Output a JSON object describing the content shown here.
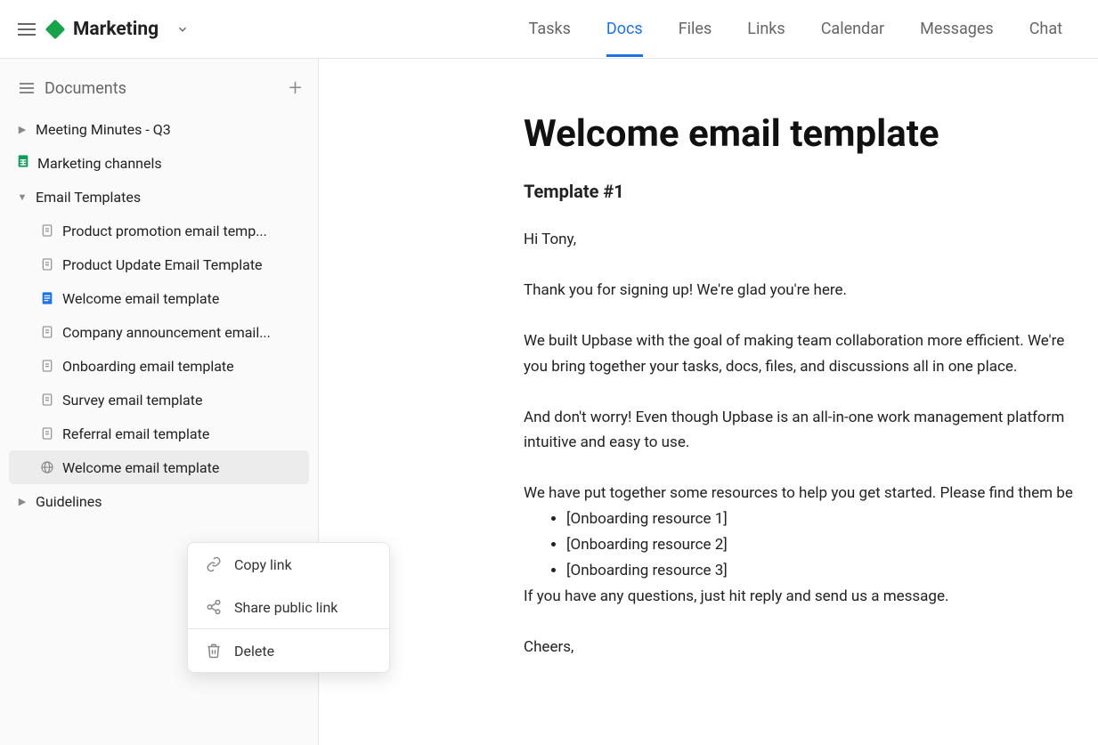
{
  "header": {
    "workspace": "Marketing",
    "tabs": [
      "Tasks",
      "Docs",
      "Files",
      "Links",
      "Calendar",
      "Messages",
      "Chat"
    ],
    "active_tab": "Docs"
  },
  "sidebar": {
    "title": "Documents",
    "items": [
      {
        "label": "Meeting Minutes - Q3",
        "type": "folder",
        "caret": "right"
      },
      {
        "label": "Marketing channels",
        "type": "sheets",
        "caret": "none"
      },
      {
        "label": "Email Templates",
        "type": "folder",
        "caret": "down",
        "children": [
          {
            "label": "Product promotion email temp...",
            "type": "doc"
          },
          {
            "label": "Product Update Email Template",
            "type": "doc"
          },
          {
            "label": "Welcome email template",
            "type": "gdoc"
          },
          {
            "label": "Company announcement email...",
            "type": "doc"
          },
          {
            "label": "Onboarding email template",
            "type": "doc"
          },
          {
            "label": "Survey email template",
            "type": "doc"
          },
          {
            "label": "Referral email template",
            "type": "doc"
          },
          {
            "label": "Welcome email template",
            "type": "public",
            "highlighted": true
          }
        ]
      },
      {
        "label": "Guidelines",
        "type": "folder",
        "caret": "right"
      }
    ]
  },
  "context_menu": {
    "copy_link": "Copy link",
    "share_public": "Share public link",
    "delete": "Delete"
  },
  "document": {
    "title": "Welcome email template",
    "section": "Template #1",
    "greeting": "Hi Tony,",
    "p1": "Thank you for signing up! We're glad you're here.",
    "p2a": "We built Upbase with the goal of making team collaboration more efficient. We're",
    "p2b": "you bring together your tasks, docs, files, and discussions all in one place.",
    "p3a": "And don't worry! Even though Upbase is an all-in-one work management platform",
    "p3b": "intuitive and easy to use.",
    "p4": "We have put together some resources to help you get started. Please find them be",
    "resources": [
      "[Onboarding resource 1]",
      "[Onboarding resource 2]",
      "[Onboarding resource 3]"
    ],
    "p5": "If you have any questions, just hit reply and send us a message.",
    "signoff": "Cheers,"
  }
}
